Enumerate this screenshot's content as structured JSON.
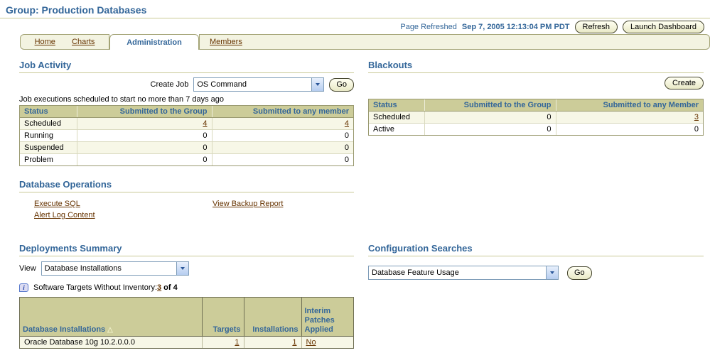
{
  "page": {
    "title": "Group: Production Databases",
    "refreshed_label": "Page Refreshed",
    "refreshed_time": "Sep 7, 2005 12:13:04 PM PDT",
    "refresh_button": "Refresh",
    "launch_dashboard_button": "Launch Dashboard"
  },
  "tabs": [
    {
      "label": "Home",
      "active": false
    },
    {
      "label": "Charts",
      "active": false
    },
    {
      "label": "Administration",
      "active": true
    },
    {
      "label": "Members",
      "active": false
    }
  ],
  "job_activity": {
    "title": "Job Activity",
    "create_job_label": "Create Job",
    "create_job_value": "OS Command",
    "go_label": "Go",
    "caption": "Job executions scheduled to start no more than 7 days ago",
    "table": {
      "headers": [
        "Status",
        "Submitted to the Group",
        "Submitted to any member"
      ],
      "rows": [
        {
          "status": "Scheduled",
          "group": "4",
          "member": "4"
        },
        {
          "status": "Running",
          "group": "0",
          "member": "0"
        },
        {
          "status": "Suspended",
          "group": "0",
          "member": "0"
        },
        {
          "status": "Problem",
          "group": "0",
          "member": "0"
        }
      ]
    }
  },
  "blackouts": {
    "title": "Blackouts",
    "create_button": "Create",
    "table": {
      "headers": [
        "Status",
        "Submitted to the Group",
        "Submitted to any Member"
      ],
      "rows": [
        {
          "status": "Scheduled",
          "group": "0",
          "member": "3"
        },
        {
          "status": "Active",
          "group": "0",
          "member": "0"
        }
      ]
    }
  },
  "database_operations": {
    "title": "Database Operations",
    "links": [
      "Execute SQL",
      "Alert Log Content",
      "View Backup Report"
    ]
  },
  "deployments_summary": {
    "title": "Deployments Summary",
    "view_label": "View",
    "view_value": "Database Installations",
    "inventory_label": "Software Targets Without Inventory:",
    "inventory_link": "3",
    "inventory_suffix": "of 4",
    "table": {
      "headers": [
        "Database Installations",
        "Targets",
        "Installations",
        "Interim Patches Applied"
      ],
      "sort_icon": "△",
      "rows": [
        {
          "name": "Oracle Database 10g 10.2.0.0.0",
          "targets": "1",
          "installations": "1",
          "patches": "No"
        }
      ]
    }
  },
  "configuration_searches": {
    "title": "Configuration Searches",
    "search_value": "Database Feature Usage",
    "go_label": "Go"
  },
  "icons": {
    "select_arrow": "chevron-down-icon",
    "info": "info-icon",
    "sort_ascending": "sort-asc-icon"
  },
  "colors": {
    "accent_blue": "#336699",
    "link_brown": "#663300",
    "table_header_bg": "#CCCC99",
    "row_alt_bg": "#F7F7E7",
    "tab_bar_bg": "#F3F3E1",
    "rule_tan": "#C9C996"
  }
}
